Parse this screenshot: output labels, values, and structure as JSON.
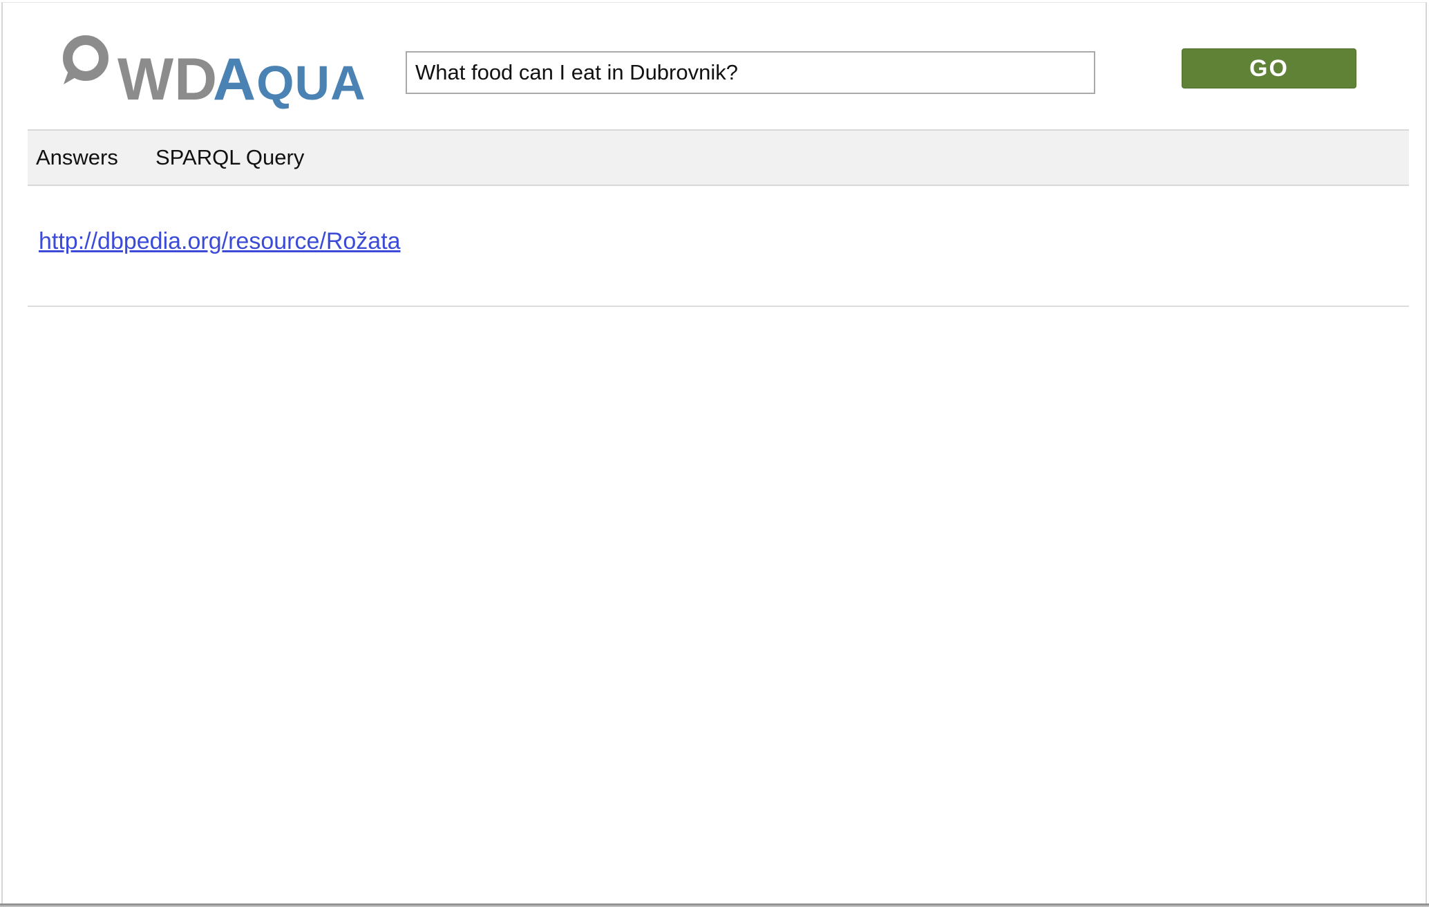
{
  "header": {
    "logo": {
      "part1": "WD",
      "part2_big": "A",
      "part2_small": "QUA",
      "colors": {
        "gray": "#8c8c8c",
        "blue": "#4a83b3"
      },
      "icon": "speech-bubble-icon"
    },
    "search": {
      "value": "What food can I eat in Dubrovnik?"
    },
    "go_label": "GO",
    "go_color": "#5f8237"
  },
  "tabs": [
    {
      "label": "Answers"
    },
    {
      "label": "SPARQL Query"
    }
  ],
  "results": {
    "answers": [
      {
        "text": "http://dbpedia.org/resource/Rožata"
      }
    ],
    "link_color": "#3b4bd8"
  }
}
